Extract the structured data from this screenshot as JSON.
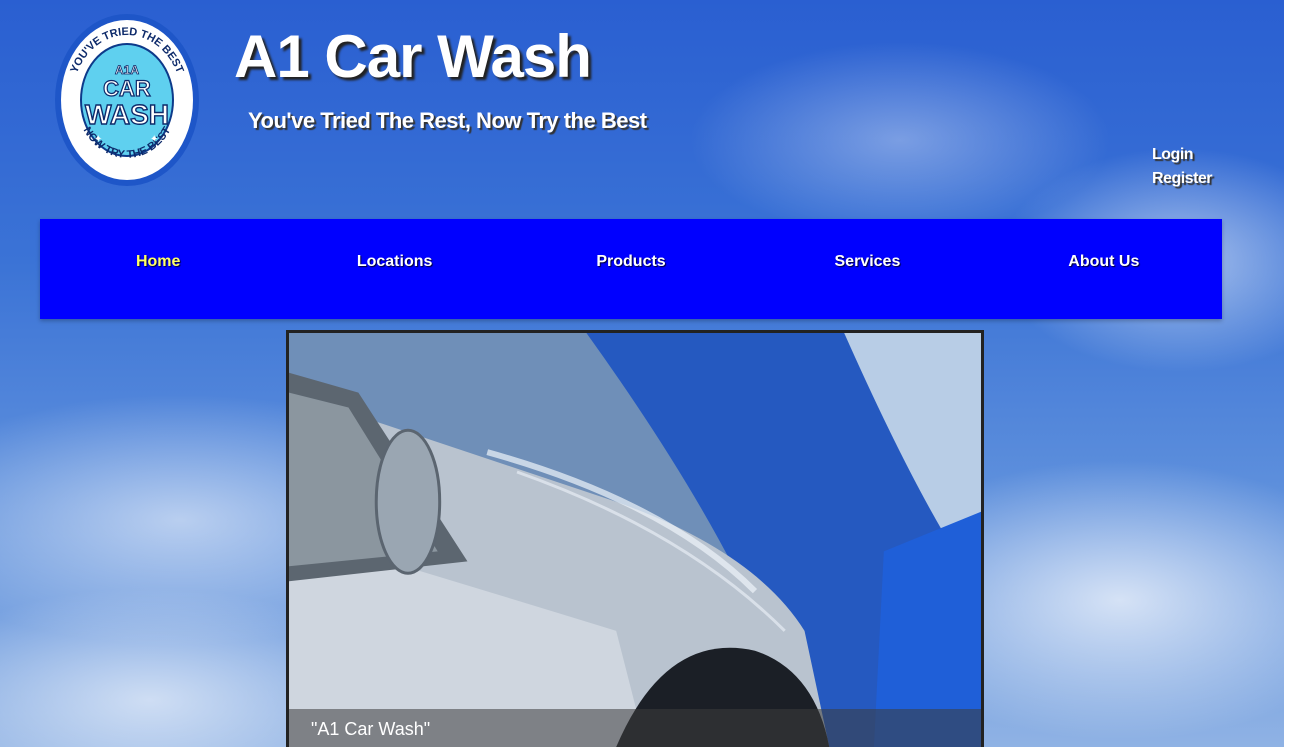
{
  "header": {
    "title": "A1 Car Wash",
    "tagline": "You've Tried The Rest, Now Try the Best"
  },
  "logo": {
    "ring_top": "YOU'VE TRIED THE BEST",
    "ring_bottom": "NOW TRY THE BEST",
    "small": "A1A",
    "line1": "CAR",
    "line2": "WASH"
  },
  "account": {
    "login": "Login",
    "register": "Register"
  },
  "nav": {
    "items": [
      {
        "label": "Home",
        "active": true
      },
      {
        "label": "Locations"
      },
      {
        "label": "Products"
      },
      {
        "label": "Services"
      },
      {
        "label": "About Us"
      }
    ]
  },
  "hero": {
    "caption": "\"A1 Car Wash\""
  },
  "colors": {
    "nav_bg": "#0000ff",
    "nav_active": "#ffff66",
    "sky": "#3b73d6"
  }
}
